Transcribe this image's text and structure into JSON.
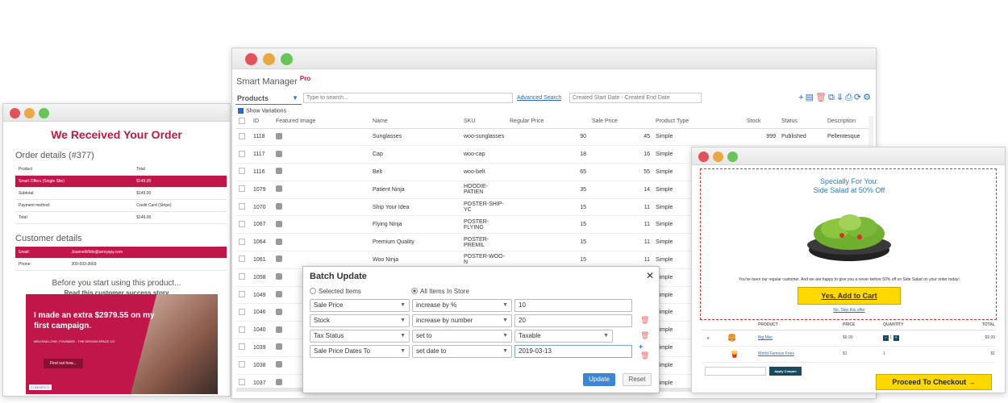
{
  "left_window": {
    "heading": "We Received Your Order",
    "order_details_title": "Order details (#377)",
    "order_table": {
      "headers": [
        "Product",
        "Total"
      ],
      "rows": [
        [
          "Smart Offers (Single Site)",
          "$149.00"
        ],
        [
          "Subtotal:",
          "$149.00"
        ],
        [
          "Payment method:",
          "Credit Card (Stripe)"
        ],
        [
          "Total:",
          "$149.00"
        ]
      ]
    },
    "customer_details_title": "Customer details",
    "customer_rows": [
      [
        "Email:",
        "JoanneWhite@armyspy.com"
      ],
      [
        "Phone:",
        "309-593-3669"
      ]
    ],
    "before_text": "Before you start using this product...",
    "story_text": "Read this customer success story",
    "banner": {
      "quote": "I made an extra $2979.55 on my first campaign.",
      "byline": "MELISSA LOVE, FOUNDER - THE DESIGN SPACE CO",
      "button": "Find out how...",
      "logo": "COMMERCE"
    }
  },
  "main_window": {
    "app_title": "Smart Manager",
    "app_title_sup": "Pro",
    "products_select": "Products",
    "search_placeholder": "Type to search...",
    "advanced_search": "Advanced Search",
    "date_range": "Created Start Date  -  Created End Date",
    "show_variations": "Show Variations",
    "columns": [
      "ID",
      "Featured Image",
      "Name",
      "SKU",
      "Regular Price",
      "Sale Price",
      "Product Type",
      "Stock",
      "Status",
      "Description"
    ],
    "rows": [
      {
        "id": "1118",
        "name": "Sunglasses",
        "sku": "woo-sunglasses",
        "reg": "90",
        "sale": "45",
        "type": "Simple",
        "stock": "999",
        "status": "Published",
        "desc": "Pellentesque"
      },
      {
        "id": "1117",
        "name": "Cap",
        "sku": "woo-cap",
        "reg": "18",
        "sale": "16",
        "type": "Simple",
        "stock": "",
        "status": "",
        "desc": ""
      },
      {
        "id": "1116",
        "name": "Belt",
        "sku": "woo-belt",
        "reg": "65",
        "sale": "55",
        "type": "Simple",
        "stock": "",
        "status": "",
        "desc": ""
      },
      {
        "id": "1079",
        "name": "Patient Ninja",
        "sku": "HOODIE-PATIEN",
        "reg": "35",
        "sale": "14",
        "type": "Simple",
        "stock": "",
        "status": "",
        "desc": ""
      },
      {
        "id": "1070",
        "name": "Ship Your Idea",
        "sku": "POSTER-SHIP-YC",
        "reg": "15",
        "sale": "11",
        "type": "Simple",
        "stock": "",
        "status": "",
        "desc": ""
      },
      {
        "id": "1067",
        "name": "Flying Ninja",
        "sku": "POSTER-FLYING",
        "reg": "15",
        "sale": "11",
        "type": "Simple",
        "stock": "",
        "status": "",
        "desc": ""
      },
      {
        "id": "1064",
        "name": "Premium Quality",
        "sku": "POSTER-PREMIL",
        "reg": "15",
        "sale": "11",
        "type": "Simple",
        "stock": "",
        "status": "",
        "desc": ""
      },
      {
        "id": "1061",
        "name": "Woo Ninja",
        "sku": "POSTER-WOO-N",
        "reg": "15",
        "sale": "11",
        "type": "Simple",
        "stock": "",
        "status": "",
        "desc": ""
      },
      {
        "id": "1058",
        "name": "",
        "sku": "",
        "reg": "",
        "sale": "",
        "type": "Simple",
        "stock": "",
        "status": "",
        "desc": ""
      },
      {
        "id": "1049",
        "name": "",
        "sku": "",
        "reg": "",
        "sale": "",
        "type": "Simple",
        "stock": "",
        "status": "",
        "desc": ""
      },
      {
        "id": "1046",
        "name": "",
        "sku": "",
        "reg": "",
        "sale": "",
        "type": "Simple",
        "stock": "",
        "status": "",
        "desc": ""
      },
      {
        "id": "1040",
        "name": "",
        "sku": "",
        "reg": "",
        "sale": "",
        "type": "Simple",
        "stock": "",
        "status": "",
        "desc": ""
      },
      {
        "id": "1039",
        "name": "",
        "sku": "",
        "reg": "",
        "sale": "",
        "type": "Simple",
        "stock": "",
        "status": "",
        "desc": ""
      },
      {
        "id": "1038",
        "name": "",
        "sku": "",
        "reg": "",
        "sale": "",
        "type": "Simple",
        "stock": "",
        "status": "",
        "desc": ""
      },
      {
        "id": "1037",
        "name": "",
        "sku": "",
        "reg": "",
        "sale": "",
        "type": "Simple",
        "stock": "",
        "status": "",
        "desc": ""
      }
    ],
    "batch": {
      "title": "Batch Update",
      "close": "✕",
      "radio_selected": "Selected Items",
      "radio_all": "All Items In Store",
      "rows": [
        {
          "field": "Sale Price",
          "op": "increase by %",
          "value": "10"
        },
        {
          "field": "Stock",
          "op": "increase by number",
          "value": "20"
        },
        {
          "field": "Tax Status",
          "op": "set to",
          "value": "Taxable"
        },
        {
          "field": "Sale Price Dates To",
          "op": "set date to",
          "value": "2019-03-13"
        }
      ],
      "update": "Update",
      "reset": "Reset"
    }
  },
  "right_window": {
    "offer_line1": "Specially For You:",
    "offer_line2": "Side Salad at 50% Off",
    "offer_message": "You've been our regular customer. And we are happy to give you a never-before 50% off on Side Salad on your order today!",
    "yes_button": "Yes, Add to Cart",
    "no_thanks": "No, Skip this offer",
    "cart_headers": [
      "PRODUCT",
      "PRICE",
      "QUANTITY",
      "TOTAL"
    ],
    "cart_rows": [
      {
        "name": "Big Mac",
        "price": "$9.99",
        "qty": "1",
        "total": "$9.99"
      },
      {
        "name": "World Famous Fries",
        "price": "$1",
        "qty": "1",
        "total": "$1"
      }
    ],
    "remove": "×",
    "apply_coupon": "Apply Coupon",
    "checkout": "Proceed To Checkout →"
  },
  "colors": {
    "brand_red": "#c0164a",
    "accent_blue": "#2a6bc1",
    "yellow": "#ffd800",
    "dark_teal": "#1a4a5e"
  }
}
